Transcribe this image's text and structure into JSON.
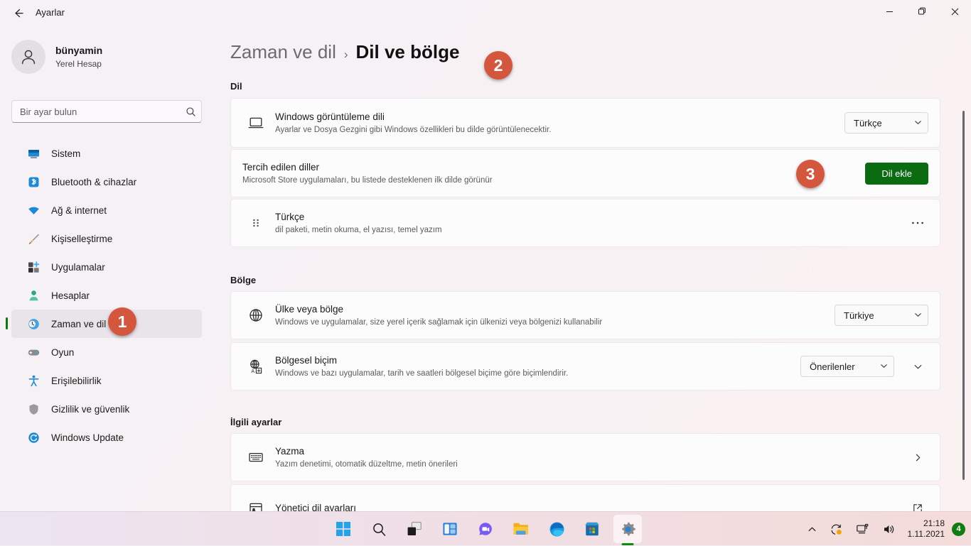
{
  "window": {
    "app_title": "Ayarlar",
    "back_icon": "back-arrow-icon",
    "minimize_icon": "minimize-icon",
    "maximize_icon": "restore-icon",
    "close_icon": "close-icon"
  },
  "account": {
    "name": "bünyamin",
    "type": "Yerel Hesap",
    "avatar_icon": "person-icon"
  },
  "search": {
    "placeholder": "Bir ayar bulun",
    "value": "",
    "icon": "search-icon"
  },
  "sidebar": {
    "items": [
      {
        "label": "Sistem",
        "icon": "system-icon",
        "active": false
      },
      {
        "label": "Bluetooth & cihazlar",
        "icon": "bluetooth-icon",
        "active": false
      },
      {
        "label": "Ağ & internet",
        "icon": "wifi-icon",
        "active": false
      },
      {
        "label": "Kişiselleştirme",
        "icon": "paintbrush-icon",
        "active": false
      },
      {
        "label": "Uygulamalar",
        "icon": "apps-icon",
        "active": false
      },
      {
        "label": "Hesaplar",
        "icon": "accounts-icon",
        "active": false
      },
      {
        "label": "Zaman ve dil",
        "icon": "clock-globe-icon",
        "active": true
      },
      {
        "label": "Oyun",
        "icon": "gamepad-icon",
        "active": false
      },
      {
        "label": "Erişilebilirlik",
        "icon": "accessibility-icon",
        "active": false
      },
      {
        "label": "Gizlilik ve güvenlik",
        "icon": "shield-icon",
        "active": false
      },
      {
        "label": "Windows Update",
        "icon": "update-icon",
        "active": false
      }
    ]
  },
  "breadcrumb": {
    "parent": "Zaman ve dil",
    "separator": "›",
    "current": "Dil ve bölge"
  },
  "sections": {
    "language": {
      "title": "Dil",
      "display_language": {
        "title": "Windows görüntüleme dili",
        "sub": "Ayarlar ve Dosya Gezgini gibi Windows özellikleri bu dilde görüntülenecektir.",
        "icon": "laptop-icon",
        "dropdown_value": "Türkçe",
        "chevron_icon": "chevron-down-icon"
      },
      "preferred_languages": {
        "title": "Tercih edilen diller",
        "sub": "Microsoft Store uygulamaları, bu listede desteklenen ilk dilde görünür",
        "button_label": "Dil ekle"
      },
      "language_entry": {
        "title": "Türkçe",
        "sub": "dil paketi, metin okuma, el yazısı, temel yazım",
        "drag_icon": "drag-handle-icon",
        "more_icon": "more-options-icon"
      }
    },
    "region": {
      "title": "Bölge",
      "country": {
        "title": "Ülke veya bölge",
        "sub": "Windows ve uygulamalar, size yerel içerik sağlamak için ülkenizi veya bölgenizi kullanabilir",
        "icon": "globe-icon",
        "dropdown_value": "Türkiye",
        "chevron_icon": "chevron-down-icon"
      },
      "regional_format": {
        "title": "Bölgesel biçim",
        "sub": "Windows ve bazı uygulamalar, tarih ve saatleri bölgesel biçime göre biçimlendirir.",
        "icon": "locale-format-icon",
        "dropdown_value": "Önerilenler",
        "chevron_icon": "chevron-down-icon",
        "expand_icon": "chevron-down-icon"
      }
    },
    "related": {
      "title": "İlgili ayarlar",
      "typing": {
        "title": "Yazma",
        "sub": "Yazım denetimi, otomatik düzeltme, metin önerileri",
        "icon": "keyboard-icon",
        "chevron_icon": "chevron-right-icon"
      },
      "admin_language": {
        "title": "Yönetici dil ayarları",
        "icon": "admin-language-icon",
        "external_icon": "external-link-icon"
      }
    }
  },
  "annotations": [
    {
      "number": "1"
    },
    {
      "number": "2"
    },
    {
      "number": "3"
    }
  ],
  "taskbar": {
    "icons": [
      {
        "name": "start-icon"
      },
      {
        "name": "search-icon"
      },
      {
        "name": "task-view-icon"
      },
      {
        "name": "widgets-icon"
      },
      {
        "name": "chat-icon"
      },
      {
        "name": "file-explorer-icon"
      },
      {
        "name": "edge-icon"
      },
      {
        "name": "microsoft-store-icon"
      },
      {
        "name": "settings-icon"
      }
    ],
    "tray": {
      "chevron_icon": "chevron-up-icon",
      "onedrive_icon": "onedrive-sync-icon",
      "network_icon": "network-icon",
      "volume_icon": "volume-icon",
      "time": "21:18",
      "date": "1.11.2021",
      "notification_count": "4"
    }
  },
  "colors": {
    "accent_green": "#0e7a0e",
    "button_green": "#0a6b11",
    "annotation_orange": "#d4563c",
    "sidebar_active": "#e9e4ea"
  }
}
